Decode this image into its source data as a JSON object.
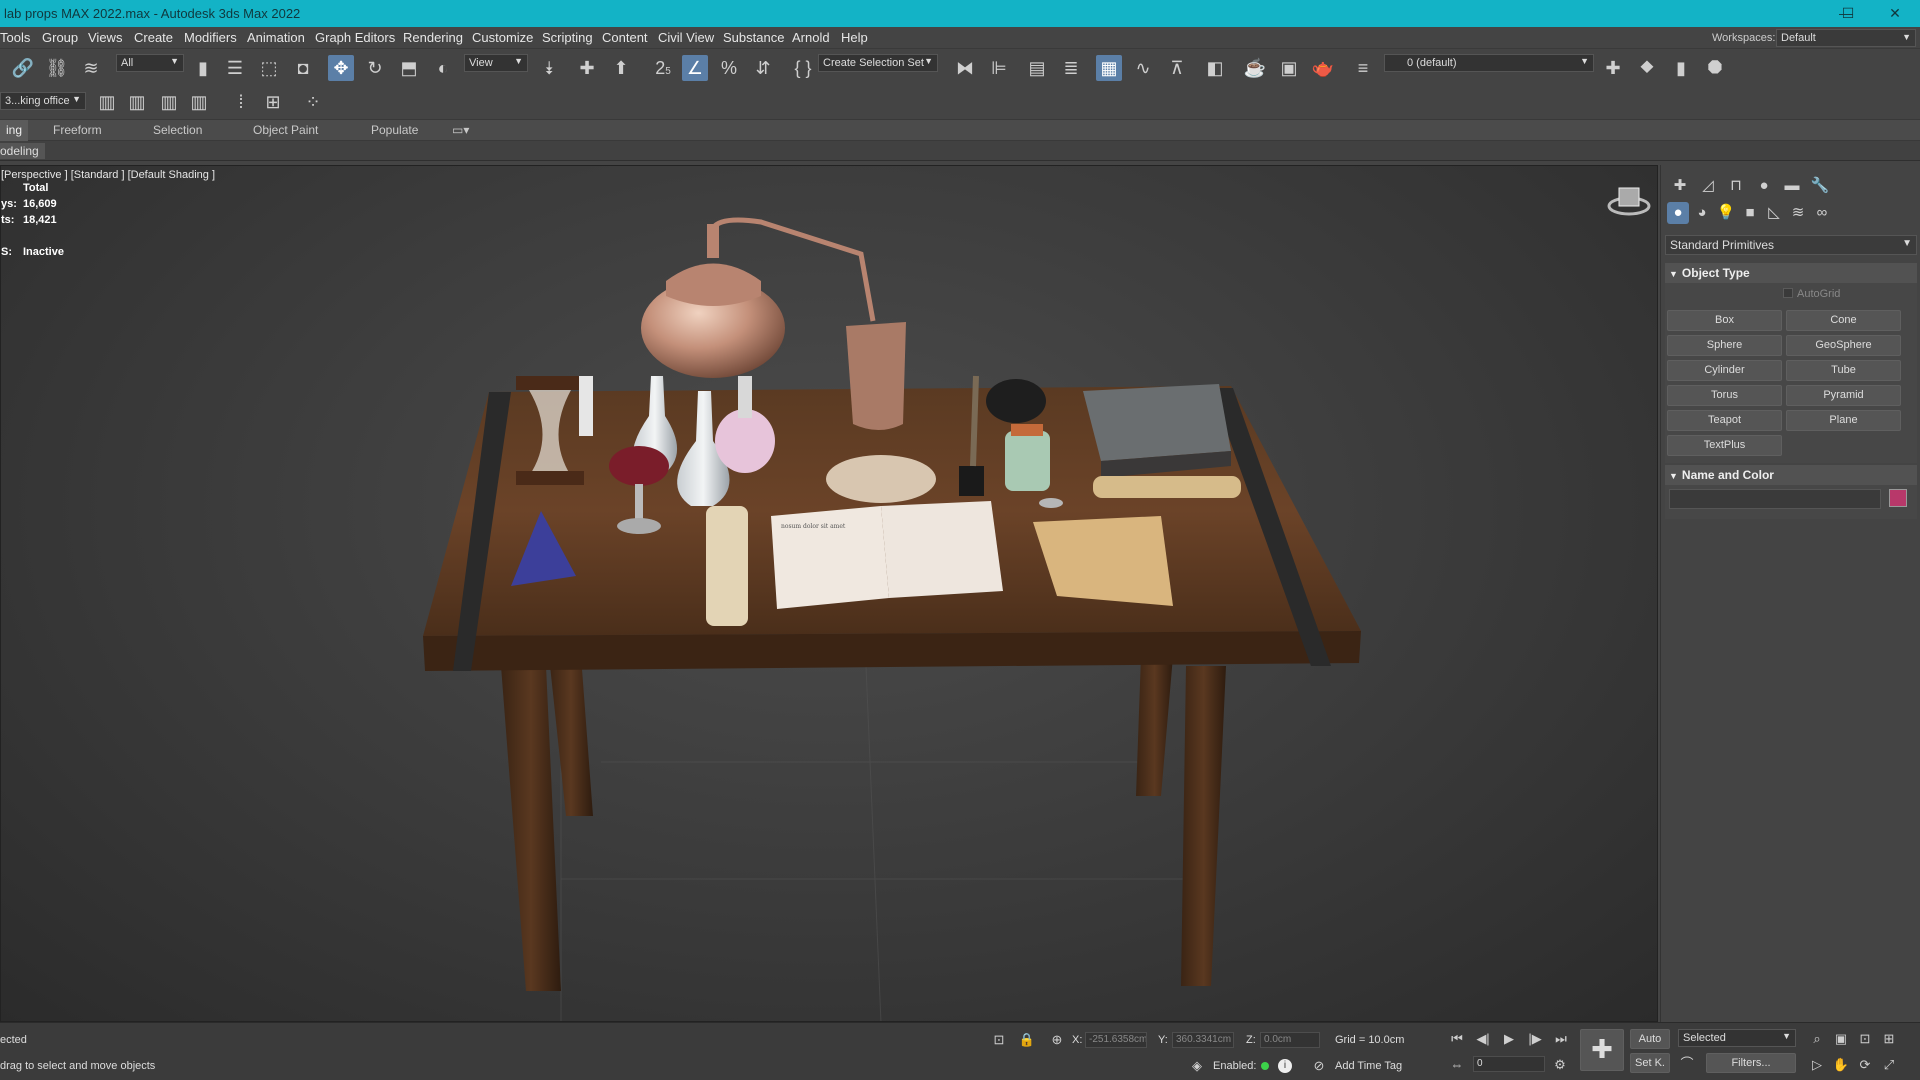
{
  "window": {
    "title": "lab props MAX 2022.max - Autodesk 3ds Max 2022",
    "minimize_icon": "—",
    "maximize_icon": "☐",
    "close_icon": "✕"
  },
  "menu": {
    "items": [
      "Tools",
      "Group",
      "Views",
      "Create",
      "Modifiers",
      "Animation",
      "Graph Editors",
      "Rendering",
      "Customize",
      "Scripting",
      "Content",
      "Civil View",
      "Substance",
      "Arnold",
      "Help"
    ],
    "workspace_label": "Workspaces:",
    "workspace_value": "Default"
  },
  "toolbar": {
    "selection_filter": "All",
    "ref_coord": "View",
    "named_selection": "Create Selection Set",
    "layer": "0 (default)",
    "scene_explorer": "3...king office",
    "snap_label": "2",
    "snap_sub": "5",
    "percent_snap": "%"
  },
  "ribbon": {
    "tabs": [
      "ing",
      "Freeform",
      "Selection",
      "Object Paint",
      "Populate"
    ],
    "active_tab": "ing",
    "sub_label": "odeling"
  },
  "viewport": {
    "label": "[Perspective ]  [Standard ]  [Default Shading ]",
    "stats": {
      "total_label": "Total",
      "polys_label": "ys:",
      "polys_value": "16,609",
      "verts_label": "ts:",
      "verts_value": "18,421",
      "fps_label": "S:",
      "fps_value": "Inactive"
    },
    "book_text": "nosum dolor sit amet",
    "scene_description": "Wooden table with alchemy lab props: copper still, flasks, hourglass, goblet, book, scrolls, parchment, ink bottle"
  },
  "command_panel": {
    "category": "Standard Primitives",
    "object_type_title": "Object Type",
    "autogrid_label": "AutoGrid",
    "buttons": [
      "Box",
      "Cone",
      "Sphere",
      "GeoSphere",
      "Cylinder",
      "Tube",
      "Torus",
      "Pyramid",
      "Teapot",
      "Plane",
      "TextPlus"
    ],
    "name_color_title": "Name and Color",
    "object_color": "#b8386a"
  },
  "status": {
    "selected_text": "ected",
    "prompt_text": "drag to select and move objects",
    "x_label": "X:",
    "x_value": "-251.6358cm",
    "y_label": "Y:",
    "y_value": "360.3341cm",
    "z_label": "Z:",
    "z_value": "0.0cm",
    "grid": "Grid = 10.0cm",
    "enabled_label": "Enabled:",
    "add_time_tag": "Add Time Tag",
    "auto_key": "Auto",
    "set_key": "Set K.",
    "key_mode": "Selected",
    "filters": "Filters...",
    "frame": "0"
  }
}
